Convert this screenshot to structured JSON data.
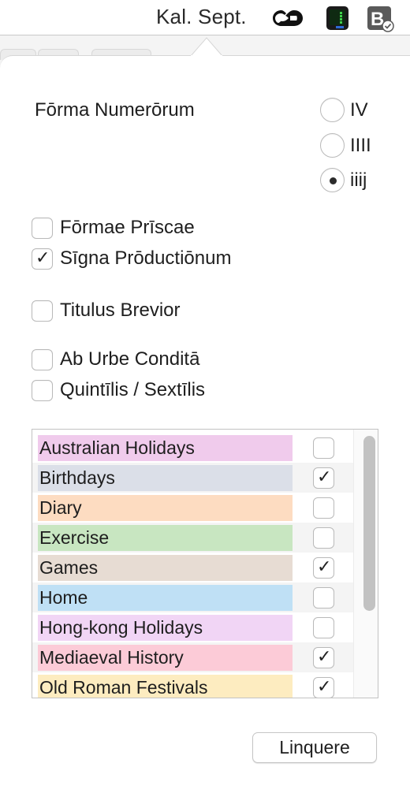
{
  "menubar": {
    "title": "Kal. Sept.",
    "icons": [
      "creative-cloud-icon",
      "activity-monitor-icon",
      "bbedit-icon"
    ]
  },
  "numerals": {
    "label": "Fōrma Numerōrum",
    "options": [
      {
        "label": "IV",
        "checked": false
      },
      {
        "label": "IIII",
        "checked": false
      },
      {
        "label": "iiij",
        "checked": true
      }
    ]
  },
  "options": [
    {
      "label": "Fōrmae Prīscae",
      "checked": false
    },
    {
      "label": "Sīgna Prōductiōnum",
      "checked": true
    },
    {
      "label": "Titulus Brevior",
      "checked": false
    },
    {
      "label": "Ab Urbe Conditā",
      "checked": false
    },
    {
      "label": "Quintīlis / Sextīlis",
      "checked": false
    }
  ],
  "calendars": [
    {
      "name": "Australian Holidays",
      "color": "#f0cbec",
      "checked": false
    },
    {
      "name": "Birthdays",
      "color": "#dbdfe8",
      "checked": true
    },
    {
      "name": "Diary",
      "color": "#fddcc1",
      "checked": false
    },
    {
      "name": "Exercise",
      "color": "#c8e6c1",
      "checked": false
    },
    {
      "name": "Games",
      "color": "#e7dcd3",
      "checked": true
    },
    {
      "name": "Home",
      "color": "#bfe0f5",
      "checked": false
    },
    {
      "name": "Hong-kong Holidays",
      "color": "#f1d5f5",
      "checked": false
    },
    {
      "name": "Mediaeval History",
      "color": "#fccbd7",
      "checked": true
    },
    {
      "name": "Old Roman Festivals",
      "color": "#fdecc0",
      "checked": true
    }
  ],
  "footer": {
    "quit_label": "Linquere"
  }
}
